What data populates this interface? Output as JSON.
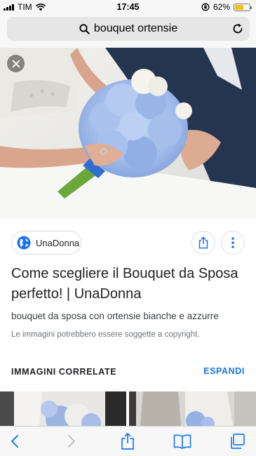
{
  "status_bar": {
    "carrier": "TIM",
    "time": "17:45",
    "battery_percent": "62%",
    "battery_level": 0.62,
    "icons": [
      "signal-bars-icon",
      "wifi-icon",
      "orientation-lock-icon",
      "battery-icon"
    ]
  },
  "address_bar": {
    "query": "bouquet ortensie",
    "search_icon": "search-icon",
    "reload_icon": "reload-icon"
  },
  "hero": {
    "close_icon": "close-icon"
  },
  "result": {
    "source": "UnaDonna",
    "title": "Come scegliere il Bouquet da Sposa perfetto! | UnaDonna",
    "description": "bouquet da sposa con ortensie bianche e azzurre",
    "copyright_note": "Le immagini potrebbero essere soggette a copyright."
  },
  "related": {
    "label": "IMMAGINI CORRELATE",
    "expand": "ESPANDI"
  },
  "toolbar": {
    "icons": [
      "back-icon",
      "forward-icon",
      "share-icon",
      "bookmarks-icon",
      "tabs-icon"
    ]
  },
  "colors": {
    "accent": "#1a73e8",
    "ios_blue": "#1a7cf5",
    "battery": "#f4c20d",
    "hydrangea": "#9db8e8",
    "ribbon": "#2f6fd0"
  }
}
